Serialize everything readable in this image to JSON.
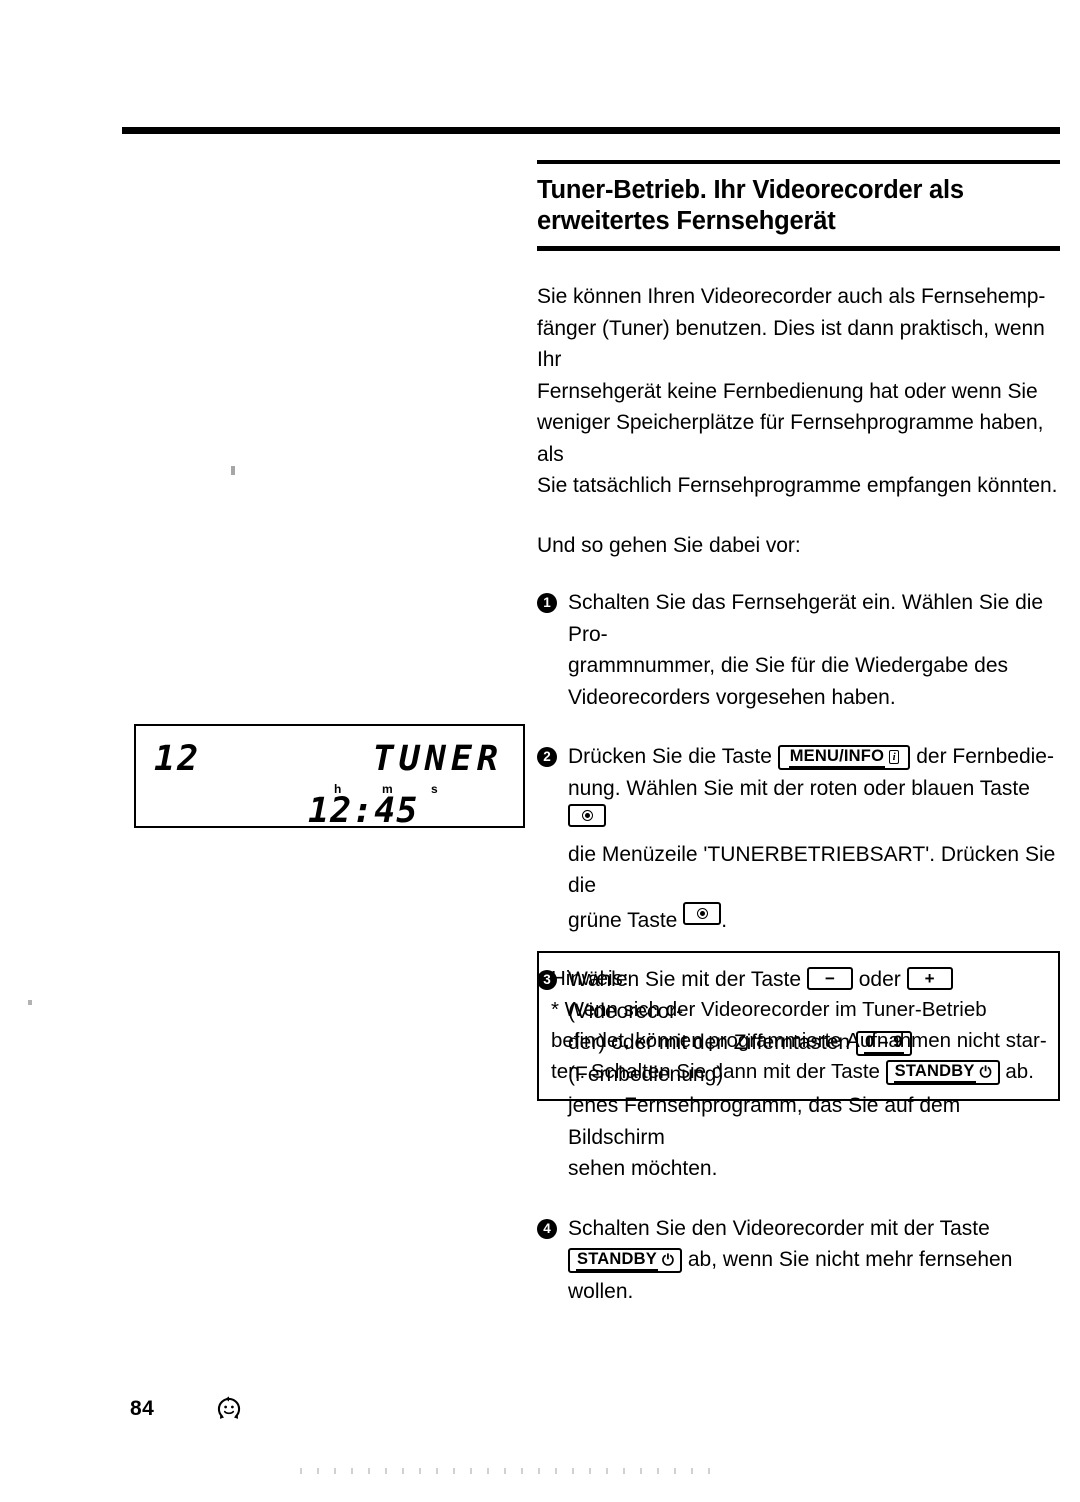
{
  "document": {
    "page_number": "84",
    "footer_icon": "smiley-recycle-icon"
  },
  "heading": {
    "line1": "Tuner-Betrieb. Ihr Videorecorder als",
    "line2": "erweitertes Fernsehgerät"
  },
  "intro": {
    "line1": "Sie können Ihren Videorecorder auch als Fernsehemp-",
    "line2": "fänger (Tuner) benutzen. Dies ist dann praktisch, wenn Ihr",
    "line3": "Fernsehgerät keine Fernbedienung hat oder wenn Sie",
    "line4": "weniger Speicherplätze für Fernsehprogramme haben, als",
    "line5": "Sie tatsächlich Fernsehprogramme empfangen könnten."
  },
  "lead_in": "Und so gehen Sie dabei vor:",
  "steps": [
    {
      "number": "1",
      "line1": "Schalten Sie das Fernsehgerät ein. Wählen Sie die Pro-",
      "line2": "grammnummer, die Sie für die Wiedergabe des",
      "line3": "Videorecorders vorgesehen haben."
    },
    {
      "number": "2",
      "t1": "Drücken Sie die Taste",
      "key1_label": "MENU/INFO",
      "key1_glyph": "i",
      "t2": "der  Fernbedie-",
      "t3": "nung. Wählen Sie mit der roten oder blauen Taste",
      "t4": "die Menüzeile 'TUNERBETRIEBSART'. Drücken Sie die",
      "t5": "grüne Taste",
      "t6": "."
    },
    {
      "number": "3",
      "t1": "Wählen Sie mit der Taste",
      "key_minus": "−",
      "t2": "oder",
      "key_plus": "+",
      "t3": "(Videorecor-",
      "t4": "der) oder mit den Zifferntasten",
      "key_digits": "0 – 9",
      "t5": "(Fernbedienung)",
      "t6": "jenes Fernsehprogramm, das Sie auf dem Bildschirm",
      "t7": "sehen möchten."
    },
    {
      "number": "4",
      "t1": "Schalten Sie den Videorecorder mit der Taste",
      "key_standby": "STANDBY",
      "key_standby_glyph": "⏻",
      "t2": "ab, wenn Sie nicht mehr fernsehen",
      "t3": "wollen."
    }
  ],
  "note": {
    "title": "Hinweis:",
    "line1": "* Wenn sich der Videorecorder im Tuner-Betrieb",
    "line2": "befindet, können programmierte Aufnahmen nicht star-",
    "line3_pre": "ten. Schalten Sie dann mit der Taste",
    "key_standby": "STANDBY",
    "key_standby_glyph": "⏻",
    "line3_post": "ab."
  },
  "vcr_display": {
    "channel": "12",
    "mode": "TUNER",
    "unit_h": "h",
    "unit_m": "m",
    "unit_s": "s",
    "time": "12:45"
  }
}
